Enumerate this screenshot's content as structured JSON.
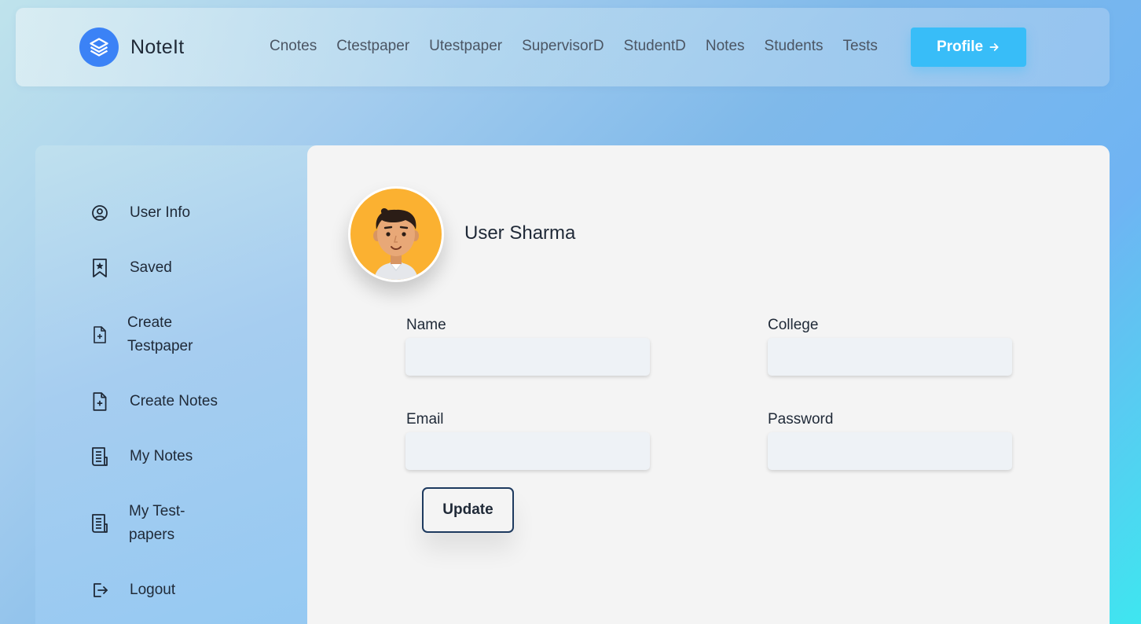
{
  "brand": {
    "name": "NoteIt",
    "logo_icon": "layers-icon"
  },
  "nav": {
    "links": [
      "Cnotes",
      "Ctestpaper",
      "Utestpaper",
      "SupervisorD",
      "StudentD",
      "Notes",
      "Students",
      "Tests"
    ],
    "profile_label": "Profile",
    "profile_icon": "arrow-right-icon"
  },
  "sidebar": {
    "items": [
      {
        "label": "User Info",
        "icon": "user-circle-icon"
      },
      {
        "label": "Saved",
        "icon": "bookmark-star-icon"
      },
      {
        "label": "Create Testpaper",
        "icon": "file-plus-icon"
      },
      {
        "label": "Create Notes",
        "icon": "file-plus-icon"
      },
      {
        "label": "My Notes",
        "icon": "document-lines-icon"
      },
      {
        "label": "My Test-papers",
        "icon": "document-lines-icon"
      },
      {
        "label": "Logout",
        "icon": "logout-icon"
      }
    ]
  },
  "profile": {
    "user_name": "User Sharma",
    "fields": {
      "name": {
        "label": "Name",
        "value": "",
        "placeholder": ""
      },
      "college": {
        "label": "College",
        "value": "",
        "placeholder": ""
      },
      "email": {
        "label": "Email",
        "value": "",
        "placeholder": ""
      },
      "password": {
        "label": "Password",
        "value": "",
        "placeholder": ""
      }
    },
    "update_label": "Update"
  },
  "colors": {
    "brand_blue": "#3b82f6",
    "profile_button": "#38bdf8",
    "avatar_bg": "#fbb131",
    "update_border": "#1e3a5f"
  }
}
